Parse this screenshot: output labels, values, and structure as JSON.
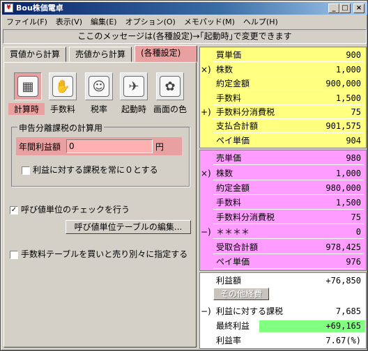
{
  "window": {
    "title": "Bou株価電卓",
    "controls": [
      "_",
      "□",
      "×"
    ]
  },
  "menu": [
    "ファイル(F)",
    "表示(V)",
    "編集(E)",
    "オプション(O)",
    "メモパッド(M)",
    "ヘルプ(H)"
  ],
  "message": "ここのメッセージは(各種設定)→｢起動時｣で変更できます",
  "tabs": [
    "買値から計算",
    "売値から計算",
    "(各種設定)"
  ],
  "settings_icons": [
    {
      "label": "計算時",
      "icon": "calculator-icon"
    },
    {
      "label": "手数料",
      "icon": "hand-icon"
    },
    {
      "label": "税率",
      "icon": "face-icon"
    },
    {
      "label": "起動時",
      "icon": "runner-icon"
    },
    {
      "label": "画面の色",
      "icon": "paint-jar-icon"
    }
  ],
  "tax_group": {
    "title": "申告分離課税の計算用",
    "annual_profit_label": "年間利益額",
    "annual_profit_value": "0",
    "unit": "円",
    "zero_tax_label": "利益に対する課税を常に０とする"
  },
  "tick_check": {
    "label": "呼び値単位のチェックを行う",
    "checked": true
  },
  "tick_table_button": "呼び値単位テーブルの編集...",
  "separate_fee_label": "手数料テーブルを買いと売り別々に指定する",
  "colors": {
    "buy": "#ffff80",
    "sell": "#ff9cff",
    "profit": "#80ff80",
    "tab_active": "#e8a0a0"
  },
  "buy": [
    {
      "prefix": "",
      "label": "買単価",
      "value": "900"
    },
    {
      "prefix": "×)",
      "label": "株数",
      "value": "1,000"
    },
    {
      "prefix": "",
      "label": "約定金額",
      "value": "900,000"
    },
    {
      "prefix": "",
      "label": "手数料",
      "value": "1,500"
    },
    {
      "prefix": "+)",
      "label": "手数料分消費税",
      "value": "75"
    },
    {
      "prefix": "",
      "label": "支払合計額",
      "value": "901,575"
    },
    {
      "prefix": "",
      "label": "ペイ単価",
      "value": "904"
    }
  ],
  "sell": [
    {
      "prefix": "",
      "label": "売単価",
      "value": "980"
    },
    {
      "prefix": "×)",
      "label": "株数",
      "value": "1,000"
    },
    {
      "prefix": "",
      "label": "約定金額",
      "value": "980,000"
    },
    {
      "prefix": "",
      "label": "手数料",
      "value": "1,500"
    },
    {
      "prefix": "",
      "label": "手数料分消費税",
      "value": "75"
    },
    {
      "prefix": "−)",
      "label": "＊＊＊＊",
      "value": "0"
    },
    {
      "prefix": "",
      "label": "受取合計額",
      "value": "978,425"
    },
    {
      "prefix": "",
      "label": "ペイ単価",
      "value": "976"
    }
  ],
  "summary": {
    "profit_label": "利益額",
    "profit_value": "+76,850",
    "other_costs_button": "その他経費",
    "tax_prefix": "−)",
    "tax_label": "利益に対する課税",
    "tax_value": "7,685",
    "final_label": "最終利益",
    "final_value": "+69,165",
    "rate_label": "利益率",
    "rate_value": "7.67(%)"
  }
}
